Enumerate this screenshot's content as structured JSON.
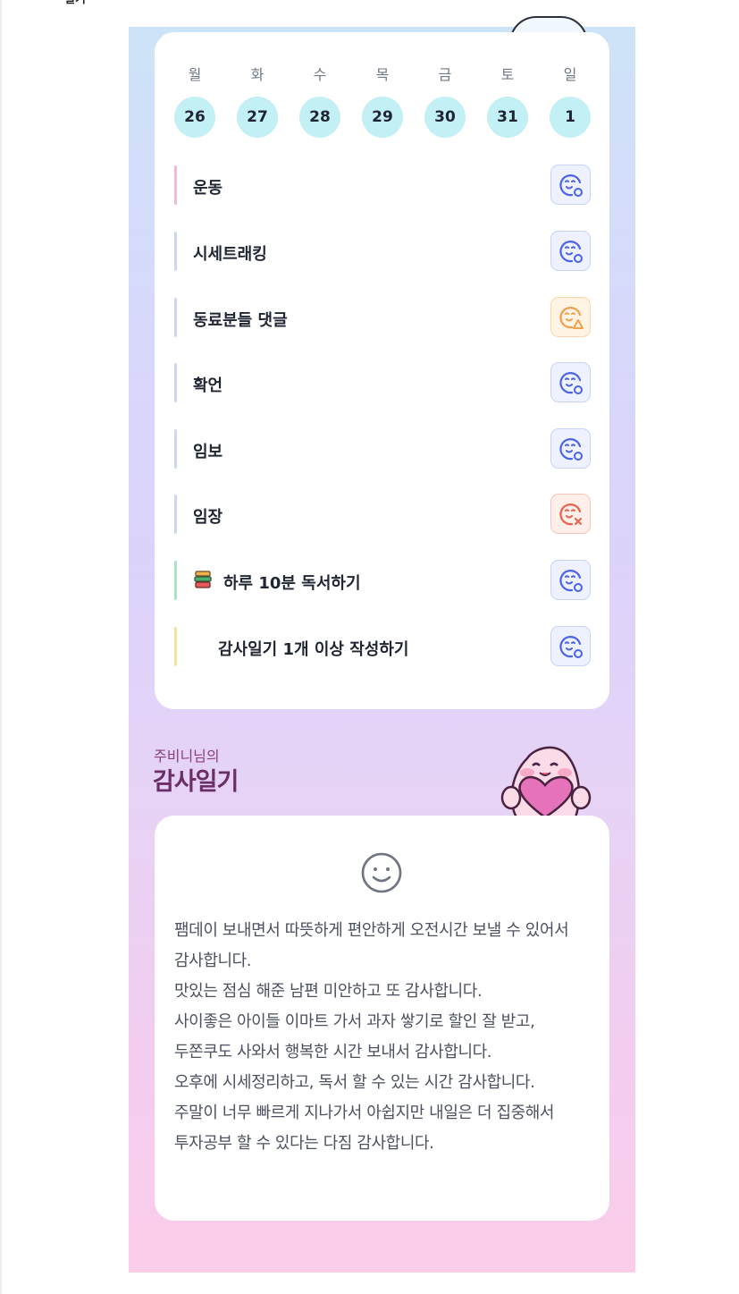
{
  "top_fragment": "일기",
  "calendar": {
    "weekdays": [
      "월",
      "화",
      "수",
      "목",
      "금",
      "토",
      "일"
    ],
    "dates": [
      "26",
      "27",
      "28",
      "29",
      "30",
      "31",
      "1"
    ]
  },
  "habits": [
    {
      "name": "운동",
      "status": "done-icon",
      "bar_color": "#f4b8d8"
    },
    {
      "name": "시세트래킹",
      "status": "done-icon",
      "bar_color": "#c9d8f4"
    },
    {
      "name": "동료분들 댓글",
      "status": "warning-icon",
      "bar_color": "#c9d8f4"
    },
    {
      "name": "확언",
      "status": "done-icon",
      "bar_color": "#c9d8f4"
    },
    {
      "name": "임보",
      "status": "done-icon",
      "bar_color": "#c9d8f4"
    },
    {
      "name": "임장",
      "status": "fail-icon",
      "bar_color": "#c9d8f4"
    },
    {
      "name": "하루 10분 독서하기",
      "status": "done-icon",
      "bar_color": "#a9e4c4",
      "icon": "book-icon"
    },
    {
      "name": "감사일기 1개 이상 작성하기",
      "status": "done-icon",
      "bar_color": "#f9dfa4"
    }
  ],
  "diary": {
    "owner": "주비니님의",
    "title": "감사일기",
    "mood_icon": "smile-icon",
    "text": "팸데이 보내면서 따뜻하게 편안하게 오전시간 보낼 수 있어서 감사합니다.\n맛있는 점심 해준 남편 미안하고 또 감사합니다.\n사이좋은 아이들 이마트 가서 과자 쌓기로 할인 잘 받고, 두쫀쿠도 사와서 행복한 시간 보내서 감사합니다.\n오후에 시세정리하고, 독서 할 수 있는 시간 감사합니다.\n주말이 너무 빠르게 지나가서 아쉽지만 내일은 더 집중해서 투자공부 할 수 있다는 다짐 감사합니다."
  },
  "colors": {
    "accent_blue": "#4a63e8",
    "warn_orange": "#f0a04b",
    "fail_red": "#e8624b",
    "title_plum": "#6b2e66"
  }
}
